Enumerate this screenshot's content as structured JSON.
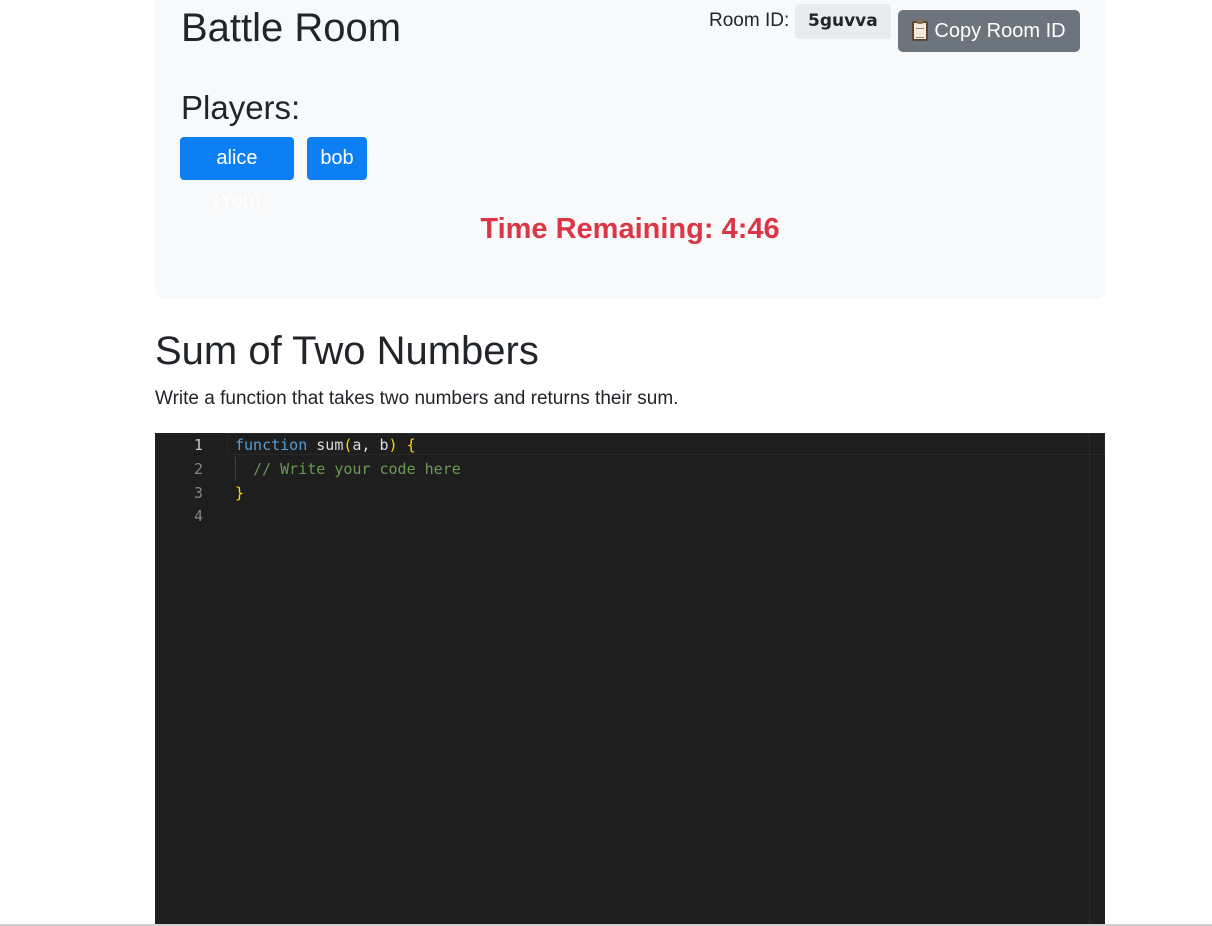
{
  "header": {
    "title": "Battle Room",
    "room_id_label": "Room ID:",
    "room_id_value": "5guvva",
    "copy_button_label": "Copy Room ID",
    "copy_button_icon": "clipboard-icon"
  },
  "players": {
    "heading": "Players:",
    "list": [
      {
        "label": "alice (You)"
      },
      {
        "label": "bob"
      }
    ]
  },
  "timer": {
    "text": "Time Remaining: 4:46"
  },
  "problem": {
    "title": "Sum of Two Numbers",
    "description": "Write a function that takes two numbers and returns their sum."
  },
  "editor": {
    "lines": [
      {
        "number": "1",
        "tokens": [
          {
            "text": "function",
            "type": "keyword"
          },
          {
            "text": " sum",
            "type": "ident"
          },
          {
            "text": "(",
            "type": "paren"
          },
          {
            "text": "a, b",
            "type": "ident"
          },
          {
            "text": ")",
            "type": "paren"
          },
          {
            "text": " ",
            "type": "ident"
          },
          {
            "text": "{",
            "type": "paren"
          }
        ]
      },
      {
        "number": "2",
        "tokens": [
          {
            "text": "  ",
            "type": "ident"
          },
          {
            "text": "// Write your code here",
            "type": "comment"
          }
        ]
      },
      {
        "number": "3",
        "tokens": [
          {
            "text": "}",
            "type": "paren"
          }
        ]
      },
      {
        "number": "4",
        "tokens": []
      }
    ]
  },
  "colors": {
    "player_badge": "#0d7ff5",
    "timer": "#dc3545",
    "copy_button": "#6c757d",
    "editor_background": "#1e1e1e",
    "keyword": "#569cd6",
    "comment": "#6a9955",
    "bracket": "#ffd700"
  }
}
